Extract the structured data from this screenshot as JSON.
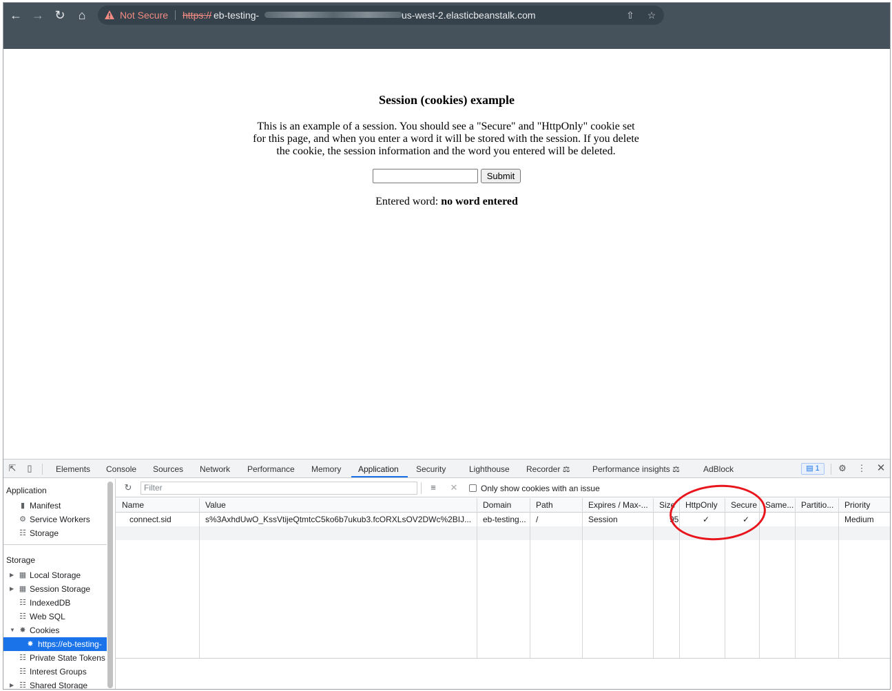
{
  "browser": {
    "security_label": "Not Secure",
    "url_scheme": "https://",
    "url_host_start": "eb-testing-",
    "url_host_end": "us-west-2.elasticbeanstalk.com"
  },
  "page": {
    "heading": "Session (cookies) example",
    "paragraph": "This is an example of a session. You should see a \"Secure\" and \"HttpOnly\" cookie set for this page, and when you enter a word it will be stored with the session. If you delete the cookie, the session information and the word you entered will be deleted.",
    "word_input_value": "",
    "submit_label": "Submit",
    "entered_label": "Entered word:",
    "entered_value": "no word entered"
  },
  "devtools": {
    "tabs": [
      "Elements",
      "Console",
      "Sources",
      "Network",
      "Performance",
      "Memory",
      "Application",
      "Security",
      "Lighthouse",
      "Recorder",
      "Performance insights",
      "AdBlock"
    ],
    "active_tab": "Application",
    "issues_count": "1",
    "sidebar": {
      "application_header": "Application",
      "application_items": [
        "Manifest",
        "Service Workers",
        "Storage"
      ],
      "storage_header": "Storage",
      "storage_items": [
        "Local Storage",
        "Session Storage",
        "IndexedDB",
        "Web SQL",
        "Cookies",
        "https://eb-testing-",
        "Private State Tokens",
        "Interest Groups",
        "Shared Storage"
      ]
    },
    "cookies": {
      "filter_placeholder": "Filter",
      "only_issues_label": "Only show cookies with an issue",
      "columns": [
        "Name",
        "Value",
        "Domain",
        "Path",
        "Expires / Max-...",
        "Size",
        "HttpOnly",
        "Secure",
        "Same...",
        "Partitio...",
        "Priority"
      ],
      "rows": [
        {
          "name": "connect.sid",
          "value": "s%3AxhdUwO_KssVtijeQtmtcC5ko6b7ukub3.fcORXLsOV2DWc%2BIJ...",
          "domain": "eb-testing...",
          "path": "/",
          "expires": "Session",
          "size": "95",
          "httponly": "✓",
          "secure": "✓",
          "samesite": "",
          "partition": "",
          "priority": "Medium"
        }
      ]
    },
    "annotation_color": "#e8161c"
  }
}
